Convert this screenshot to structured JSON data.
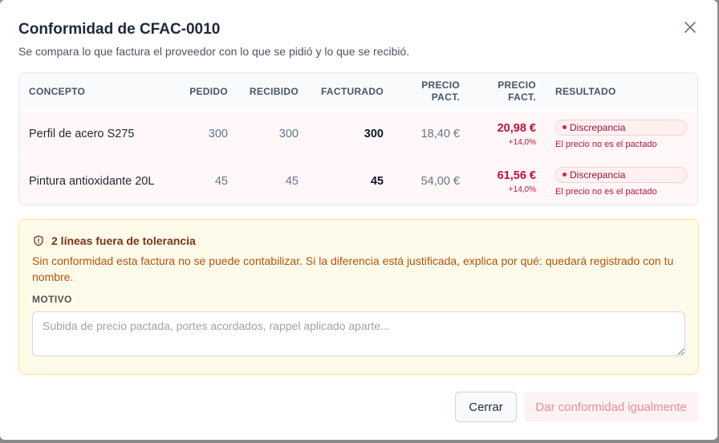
{
  "dialog": {
    "title": "Conformidad de CFAC-0010",
    "subtitle": "Se compara lo que factura el proveedor con lo que se pidió y lo que se recibió."
  },
  "table": {
    "headers": {
      "concepto": "CONCEPTO",
      "pedido": "PEDIDO",
      "recibido": "RECIBIDO",
      "facturado": "FACTURADO",
      "precio_pact_1": "PRECIO",
      "precio_pact_2": "PACT.",
      "precio_fact_1": "PRECIO",
      "precio_fact_2": "FACT.",
      "resultado": "RESULTADO"
    },
    "rows": [
      {
        "concepto": "Perfil de acero S275",
        "pedido": "300",
        "recibido": "300",
        "facturado": "300",
        "precio_pact": "18,40 €",
        "precio_fact": "20,98 €",
        "delta": "+14,0%",
        "resultado": "Discrepancia",
        "motivo": "El precio no es el pactado"
      },
      {
        "concepto": "Pintura antioxidante 20L",
        "pedido": "45",
        "recibido": "45",
        "facturado": "45",
        "precio_pact": "54,00 €",
        "precio_fact": "61,56 €",
        "delta": "+14,0%",
        "resultado": "Discrepancia",
        "motivo": "El precio no es el pactado"
      }
    ]
  },
  "warning": {
    "title": "2 líneas fuera de tolerancia",
    "text": "Sin conformidad esta factura no se puede contabilizar. Si la diferencia está justificada, explica por qué: quedará registrado con tu nombre.",
    "motivo_label": "MOTIVO",
    "motivo_placeholder": "Subida de precio pactada, portes acordados, rappel aplicado aparte...",
    "motivo_value": ""
  },
  "buttons": {
    "cerrar": "Cerrar",
    "dar_conformidad": "Dar conformidad igualmente"
  },
  "colors": {
    "danger": "#be123c",
    "warning_bg": "#fffbeb",
    "warning_text": "#b45309"
  }
}
